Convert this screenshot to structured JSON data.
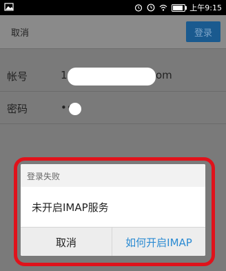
{
  "status_bar": {
    "time": "上午9:15"
  },
  "topbar": {
    "cancel_label": "取消",
    "login_label": "登录"
  },
  "form": {
    "account_label": "帐号",
    "account_value_prefix": "1",
    "account_value_suffix": "om",
    "password_label": "密码",
    "password_value": "••"
  },
  "dialog": {
    "title": "登录失败",
    "message": "未开启IMAP服务",
    "cancel_label": "取消",
    "howto_label": "如何开启IMAP"
  },
  "colors": {
    "accent": "#2a8ad2",
    "highlight": "#e0121b"
  }
}
